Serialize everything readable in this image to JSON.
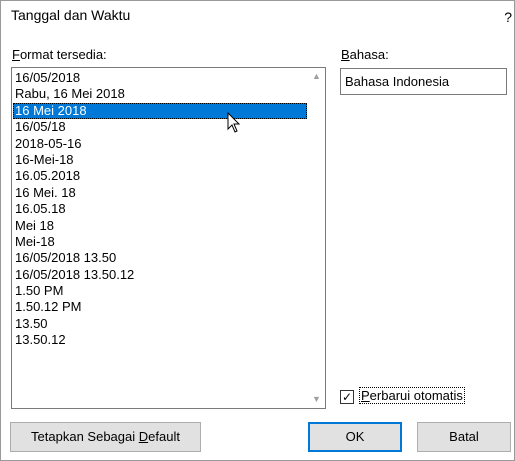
{
  "dialog": {
    "title": "Tanggal dan Waktu",
    "help": "?"
  },
  "formats": {
    "label_underlined": "F",
    "label_rest": "ormat tersedia:",
    "items": [
      "16/05/2018",
      "Rabu, 16 Mei 2018",
      "16 Mei 2018",
      "16/05/18",
      "2018-05-16",
      "16-Mei-18",
      "16.05.2018",
      "16 Mei. 18",
      "16.05.18",
      "Mei 18",
      "Mei-18",
      "16/05/2018 13.50",
      "16/05/2018 13.50.12",
      "1.50 PM",
      "1.50.12 PM",
      "13.50",
      "13.50.12"
    ],
    "selected": "16 Mei 2018"
  },
  "language": {
    "label_underlined": "B",
    "label_rest": "ahasa:",
    "value": "Bahasa Indonesia"
  },
  "auto_update": {
    "checked": true,
    "check_glyph": "✓",
    "label_underlined": "P",
    "label_rest": "erbarui otomatis"
  },
  "buttons": {
    "default_pre": "Tetapkan Sebagai ",
    "default_underlined": "D",
    "default_post": "efault",
    "ok": "OK",
    "cancel": "Batal"
  },
  "scrollbar": {
    "up": "▲",
    "down": "▼"
  },
  "colors": {
    "selection": "#0078d7",
    "button_face": "#e1e1e1",
    "focus_border": "#0078d7"
  }
}
